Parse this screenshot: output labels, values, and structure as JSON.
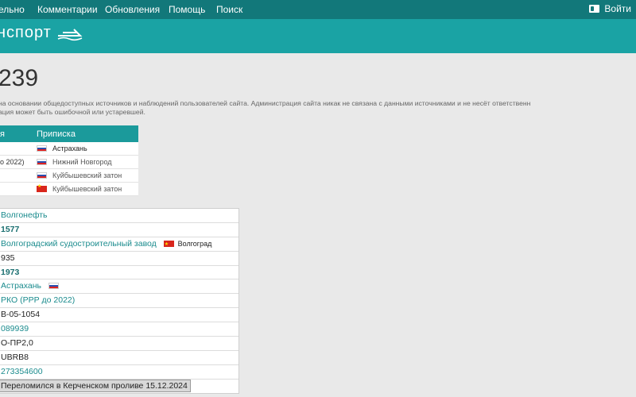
{
  "nav": {
    "items": [
      "ельно",
      "Комментарии",
      "Обновления",
      "Помощь",
      "Поиск"
    ],
    "login": "Войти"
  },
  "banner": {
    "logo_text": "нспорт"
  },
  "page": {
    "title": "239",
    "disclaimer_line1": "на основании общедоступных источников и наблюдений пользователей сайта. Администрация сайта никак не связана с данными источниками и не несёт ответственн",
    "disclaimer_line2": "ация может быть ошибочной или устаревшей."
  },
  "names_table": {
    "col1": "я",
    "col2": "Приписка",
    "rows": [
      {
        "left": "",
        "flag": "ru",
        "port": "Астрахань"
      },
      {
        "left": "о 2022)",
        "flag": "ru",
        "port": "Нижний Новгород"
      },
      {
        "left": "",
        "flag": "ru",
        "port": "Куйбышевский затон"
      },
      {
        "left": "",
        "flag": "cn",
        "port": "Куйбышевский затон"
      }
    ]
  },
  "info_rows": [
    {
      "text": "Волгонефть",
      "style": "link"
    },
    {
      "text": "1577",
      "style": "bold"
    },
    {
      "text": "Волгоградский судостроительный завод",
      "style": "link",
      "flag": "cn",
      "city": "Волгоград"
    },
    {
      "text": "935",
      "style": "plain"
    },
    {
      "text": "1973",
      "style": "bold"
    },
    {
      "text": "Астрахань",
      "style": "link",
      "flag": "ru"
    },
    {
      "text": "РКО (РРР до 2022)",
      "style": "link"
    },
    {
      "text": "В-05-1054",
      "style": "plain"
    },
    {
      "text": "089939",
      "style": "link"
    },
    {
      "text": "О-ПР2,0",
      "style": "plain"
    },
    {
      "text": "UBRB8",
      "style": "plain"
    },
    {
      "text": "273354600",
      "style": "link"
    },
    {
      "text": "Переломился в Керченском проливе 15.12.2024",
      "style": "note"
    }
  ],
  "colors": {
    "nav_bg": "#12787a",
    "banner_bg": "#1aa3a4",
    "link": "#1a8b8d",
    "table_head": "#1b9a9b"
  }
}
